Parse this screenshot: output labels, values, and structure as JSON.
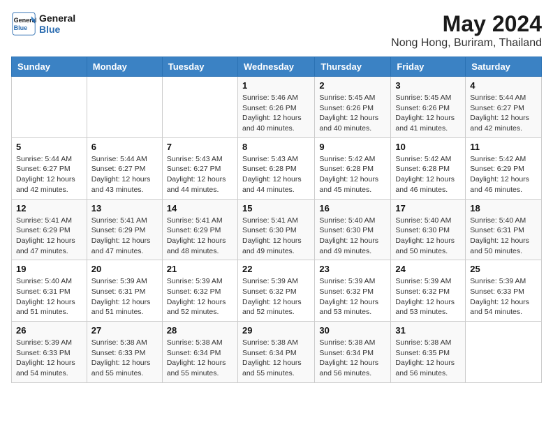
{
  "header": {
    "logo_line1": "General",
    "logo_line2": "Blue",
    "month_title": "May 2024",
    "location": "Nong Hong, Buriram, Thailand"
  },
  "days_of_week": [
    "Sunday",
    "Monday",
    "Tuesday",
    "Wednesday",
    "Thursday",
    "Friday",
    "Saturday"
  ],
  "weeks": [
    [
      {
        "day": "",
        "info": ""
      },
      {
        "day": "",
        "info": ""
      },
      {
        "day": "",
        "info": ""
      },
      {
        "day": "1",
        "info": "Sunrise: 5:46 AM\nSunset: 6:26 PM\nDaylight: 12 hours and 40 minutes."
      },
      {
        "day": "2",
        "info": "Sunrise: 5:45 AM\nSunset: 6:26 PM\nDaylight: 12 hours and 40 minutes."
      },
      {
        "day": "3",
        "info": "Sunrise: 5:45 AM\nSunset: 6:26 PM\nDaylight: 12 hours and 41 minutes."
      },
      {
        "day": "4",
        "info": "Sunrise: 5:44 AM\nSunset: 6:27 PM\nDaylight: 12 hours and 42 minutes."
      }
    ],
    [
      {
        "day": "5",
        "info": "Sunrise: 5:44 AM\nSunset: 6:27 PM\nDaylight: 12 hours and 42 minutes."
      },
      {
        "day": "6",
        "info": "Sunrise: 5:44 AM\nSunset: 6:27 PM\nDaylight: 12 hours and 43 minutes."
      },
      {
        "day": "7",
        "info": "Sunrise: 5:43 AM\nSunset: 6:27 PM\nDaylight: 12 hours and 44 minutes."
      },
      {
        "day": "8",
        "info": "Sunrise: 5:43 AM\nSunset: 6:28 PM\nDaylight: 12 hours and 44 minutes."
      },
      {
        "day": "9",
        "info": "Sunrise: 5:42 AM\nSunset: 6:28 PM\nDaylight: 12 hours and 45 minutes."
      },
      {
        "day": "10",
        "info": "Sunrise: 5:42 AM\nSunset: 6:28 PM\nDaylight: 12 hours and 46 minutes."
      },
      {
        "day": "11",
        "info": "Sunrise: 5:42 AM\nSunset: 6:29 PM\nDaylight: 12 hours and 46 minutes."
      }
    ],
    [
      {
        "day": "12",
        "info": "Sunrise: 5:41 AM\nSunset: 6:29 PM\nDaylight: 12 hours and 47 minutes."
      },
      {
        "day": "13",
        "info": "Sunrise: 5:41 AM\nSunset: 6:29 PM\nDaylight: 12 hours and 47 minutes."
      },
      {
        "day": "14",
        "info": "Sunrise: 5:41 AM\nSunset: 6:29 PM\nDaylight: 12 hours and 48 minutes."
      },
      {
        "day": "15",
        "info": "Sunrise: 5:41 AM\nSunset: 6:30 PM\nDaylight: 12 hours and 49 minutes."
      },
      {
        "day": "16",
        "info": "Sunrise: 5:40 AM\nSunset: 6:30 PM\nDaylight: 12 hours and 49 minutes."
      },
      {
        "day": "17",
        "info": "Sunrise: 5:40 AM\nSunset: 6:30 PM\nDaylight: 12 hours and 50 minutes."
      },
      {
        "day": "18",
        "info": "Sunrise: 5:40 AM\nSunset: 6:31 PM\nDaylight: 12 hours and 50 minutes."
      }
    ],
    [
      {
        "day": "19",
        "info": "Sunrise: 5:40 AM\nSunset: 6:31 PM\nDaylight: 12 hours and 51 minutes."
      },
      {
        "day": "20",
        "info": "Sunrise: 5:39 AM\nSunset: 6:31 PM\nDaylight: 12 hours and 51 minutes."
      },
      {
        "day": "21",
        "info": "Sunrise: 5:39 AM\nSunset: 6:32 PM\nDaylight: 12 hours and 52 minutes."
      },
      {
        "day": "22",
        "info": "Sunrise: 5:39 AM\nSunset: 6:32 PM\nDaylight: 12 hours and 52 minutes."
      },
      {
        "day": "23",
        "info": "Sunrise: 5:39 AM\nSunset: 6:32 PM\nDaylight: 12 hours and 53 minutes."
      },
      {
        "day": "24",
        "info": "Sunrise: 5:39 AM\nSunset: 6:32 PM\nDaylight: 12 hours and 53 minutes."
      },
      {
        "day": "25",
        "info": "Sunrise: 5:39 AM\nSunset: 6:33 PM\nDaylight: 12 hours and 54 minutes."
      }
    ],
    [
      {
        "day": "26",
        "info": "Sunrise: 5:39 AM\nSunset: 6:33 PM\nDaylight: 12 hours and 54 minutes."
      },
      {
        "day": "27",
        "info": "Sunrise: 5:38 AM\nSunset: 6:33 PM\nDaylight: 12 hours and 55 minutes."
      },
      {
        "day": "28",
        "info": "Sunrise: 5:38 AM\nSunset: 6:34 PM\nDaylight: 12 hours and 55 minutes."
      },
      {
        "day": "29",
        "info": "Sunrise: 5:38 AM\nSunset: 6:34 PM\nDaylight: 12 hours and 55 minutes."
      },
      {
        "day": "30",
        "info": "Sunrise: 5:38 AM\nSunset: 6:34 PM\nDaylight: 12 hours and 56 minutes."
      },
      {
        "day": "31",
        "info": "Sunrise: 5:38 AM\nSunset: 6:35 PM\nDaylight: 12 hours and 56 minutes."
      },
      {
        "day": "",
        "info": ""
      }
    ]
  ]
}
